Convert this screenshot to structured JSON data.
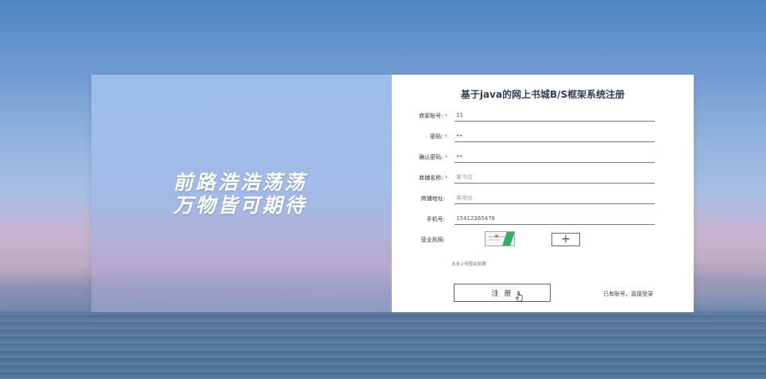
{
  "left_panel": {
    "slogan_line1": "前路浩浩荡荡",
    "slogan_line2": "万物皆可期待"
  },
  "form": {
    "title": "基于java的网上书城B/S框架系统注册",
    "required_mark": "*",
    "fields": [
      {
        "label": "商家账号:",
        "required": true,
        "value": "11",
        "placeholder": ""
      },
      {
        "label": "密码:",
        "required": true,
        "value": "••",
        "placeholder": ""
      },
      {
        "label": "确认密码:",
        "required": true,
        "value": "••",
        "placeholder": ""
      },
      {
        "label": "商铺名称:",
        "required": true,
        "value": "",
        "placeholder": "某书店"
      },
      {
        "label": "商铺地址:",
        "required": false,
        "value": "",
        "placeholder": "某地址"
      },
      {
        "label": "手机号:",
        "required": false,
        "value": "15412365478",
        "placeholder": ""
      }
    ],
    "license": {
      "label": "营业执照:",
      "upload_icon": "+",
      "hint": "点击上传营业执照"
    },
    "submit_label": "注 册",
    "login_link": "已有账号，直接登录"
  },
  "colors": {
    "accent": "#54667a",
    "required": "#e05050",
    "panel_white": "#ffffff"
  }
}
